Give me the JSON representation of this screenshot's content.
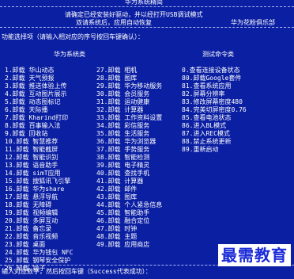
{
  "header": {
    "title": "华为系统精简",
    "notice_line1": "请确定已经安装好驱动，并以经打开USB调试模式",
    "notice_line2": "双请系统后，应用自动恢复",
    "club": "华为花粉俱乐部"
  },
  "menu": {
    "prompt": "功能选择项（请输入相对应的序号按回车键确认）：",
    "col1_heading": "华为系统类",
    "col3_heading": "测试命令类",
    "col1": [
      "1.卸载 华山动态",
      "2.卸载 天气预报",
      "3.卸载 推送体验上传",
      "4.卸载 互动图片展示",
      "5.卸载 动态图标记",
      "6.卸载 天际播",
      "7.卸载 Kharind打印",
      "8.卸载 百事输入法",
      "9.卸载 回收站",
      "10.卸载 智慧推荐",
      "11.卸载 智能截屏",
      "12.卸载 智能识别",
      "13.卸载 语音助手",
      "14.卸载 simT应用",
      "15.卸载 搜狐讯飞引擎",
      "16.卸载 华为share",
      "17.卸载 悬浮导航",
      "18.卸载 无障碍",
      "19.卸载 视频编辑",
      "20.卸载 多屏互动",
      "21.卸载 备忘录",
      "22.卸载 音乐视频",
      "23.卸载 桌面",
      "24.卸载 华为钱包 NFC",
      "25.卸载 钢琴安全保护",
      "26.卸载 镜子"
    ],
    "col2": [
      "27.卸载 相机",
      "28.卸载 图库",
      "29.卸载 华为移动服务",
      "30.卸载 会员服务",
      "31.卸载 运动健康",
      "32.卸载 计算器",
      "33.卸载 工作资料设置",
      "34.卸载 彩信服务",
      "35.卸载 生活服务",
      "36.卸载 华为浏览器",
      "37.卸载 手势服务",
      "38.卸载 智能检测",
      "39.卸载 电子精灵",
      "40.卸载 查找手机",
      "41.卸载 计算器",
      "42.卸载 邮件",
      "43.卸载 图库",
      "44.卸载 个人紧急信息",
      "45.卸载 智能助手",
      "46.卸载 融合定位",
      "47.卸载 时钟",
      "48.卸载 主题",
      "49.卸载 应用商店"
    ],
    "col3": [
      "0.查看连接设备状态",
      "80.卸载Google套件",
      "81.查看系统应用",
      "82.屏幕分辨率",
      "83.修改屏幕密度480",
      "84.完美切屏密度0.76",
      "85.查看电池状态",
      "86.进入BL模式",
      "87.进入REC模式",
      "88.禁止系统更新",
      "89.重新启动"
    ]
  },
  "footer": {
    "input_prompt": "输入对应数字，然后按回车键（Success代表成功）："
  },
  "watermark": "最需教育",
  "colors": {
    "background": "#0b1fa3",
    "text": "#ffffff",
    "watermark": "#1b2bd8"
  }
}
